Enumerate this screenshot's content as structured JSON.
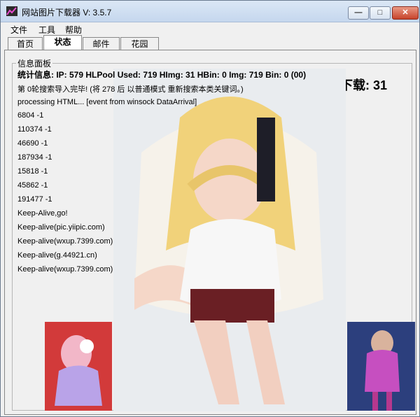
{
  "window": {
    "title": "网站图片下载器 V: 3.5.7",
    "controls": {
      "minimize": "—",
      "maximize": "□",
      "close": "✕"
    }
  },
  "menu": [
    "文件",
    "工具",
    "帮助"
  ],
  "tabs": [
    {
      "label": "首页",
      "active": false
    },
    {
      "label": "状态",
      "active": true
    },
    {
      "label": "邮件",
      "active": false
    },
    {
      "label": "花园",
      "active": false
    }
  ],
  "panel": {
    "group_label": "信息面板",
    "stats_label": "统计信息:",
    "stats_value": "IP: 579 HLPool Used: 719 HImg: 31 HBin: 0 Img: 719 Bin: 0 (00)",
    "download_label": "下载: 31",
    "log": [
      "第 0轮搜索导入完毕! (将 278 后 以普通模式 重新搜索本类关键词。)",
      "processing HTML... [event from winsock DataArrival]",
      "6804 -1",
      "110374 -1",
      "46690 -1",
      "187934 -1",
      "15818 -1",
      "45862 -1",
      "191477 -1",
      "Keep-Alive,go!",
      "Keep-alive(pic.yiipic.com)",
      "Keep-alive(wxup.7399.com)",
      "Keep-alive(g.44921.cn)",
      "Keep-alive(wxup.7399.com)"
    ]
  },
  "images": {
    "main": "photo-main",
    "left_thumb": "photo-thumb-left",
    "right_thumb": "photo-thumb-right"
  }
}
